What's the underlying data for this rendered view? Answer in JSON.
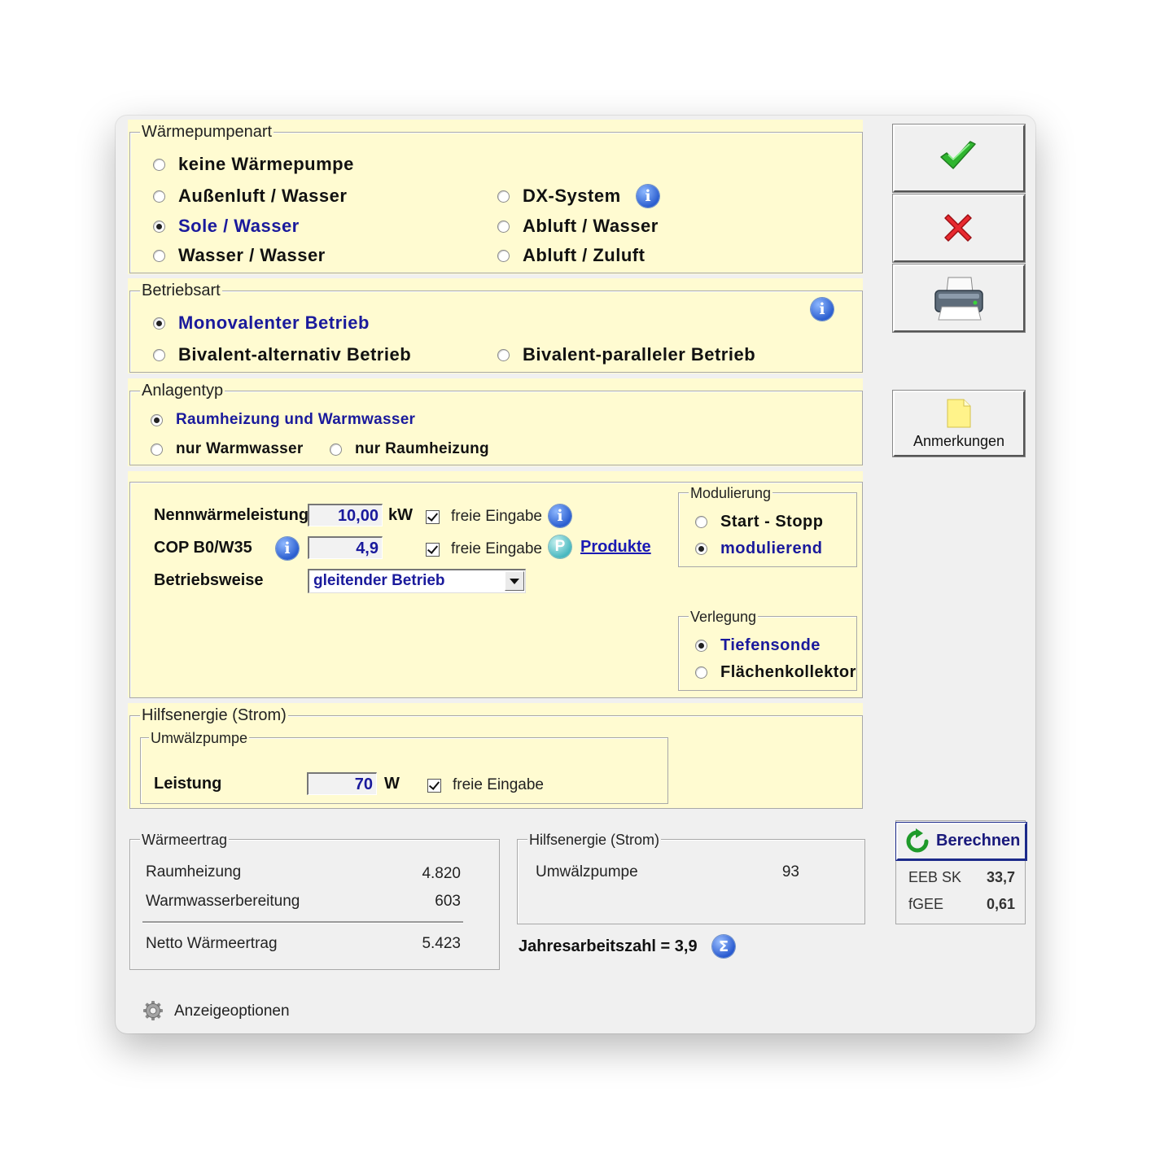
{
  "waermepumpenart": {
    "legend": "Wärmepumpenart",
    "options": [
      "keine Wärmepumpe",
      "Außenluft / Wasser",
      "Sole / Wasser",
      "Wasser / Wasser",
      "DX-System",
      "Abluft / Wasser",
      "Abluft / Zuluft"
    ],
    "selected": "Sole / Wasser"
  },
  "betriebsart": {
    "legend": "Betriebsart",
    "options": [
      "Monovalenter Betrieb",
      "Bivalent-alternativ Betrieb",
      "Bivalent-paralleler Betrieb"
    ],
    "selected": "Monovalenter Betrieb"
  },
  "anlagentyp": {
    "legend": "Anlagentyp",
    "options": [
      "Raumheizung und Warmwasser",
      "nur Warmwasser",
      "nur Raumheizung"
    ],
    "selected": "Raumheizung und Warmwasser"
  },
  "params": {
    "nennwaerme_label": "Nennwärmeleistung",
    "nennwaerme_value": "10,00",
    "nennwaerme_unit": "kW",
    "cop_label": "COP B0/W35",
    "cop_value": "4,9",
    "freie_eingabe": "freie Eingabe",
    "produkte": "Produkte",
    "betriebsweise_label": "Betriebsweise",
    "betriebsweise_value": "gleitender Betrieb"
  },
  "modulierung": {
    "legend": "Modulierung",
    "options": [
      "Start - Stopp",
      "modulierend"
    ],
    "selected": "modulierend"
  },
  "verlegung": {
    "legend": "Verlegung",
    "options": [
      "Tiefensonde",
      "Flächenkollektor"
    ],
    "selected": "Tiefensonde"
  },
  "hilfsenergie": {
    "legend": "Hilfsenergie (Strom)",
    "sub_legend": "Umwälzpumpe",
    "leistung_label": "Leistung",
    "leistung_value": "70",
    "leistung_unit": "W",
    "freie_eingabe": "freie Eingabe"
  },
  "waermeertrag": {
    "legend": "Wärmeertrag",
    "rows": [
      {
        "label": "Raumheizung",
        "value": "4.820"
      },
      {
        "label": "Warmwasserbereitung",
        "value": "603"
      }
    ],
    "total_label": "Netto Wärmeertrag",
    "total_value": "5.423"
  },
  "hilfsenergie_result": {
    "legend": "Hilfsenergie (Strom)",
    "label": "Umwälzpumpe",
    "value": "93"
  },
  "jaz": "Jahresarbeitszahl = 3,9",
  "side": {
    "anmerkungen": "Anmerkungen",
    "berechnen": "Berechnen",
    "eeb_label": "EEB SK",
    "eeb_value": "33,7",
    "fgee_label": "fGEE",
    "fgee_value": "0,61"
  },
  "anzeigeoptionen": "Anzeigeoptionen"
}
